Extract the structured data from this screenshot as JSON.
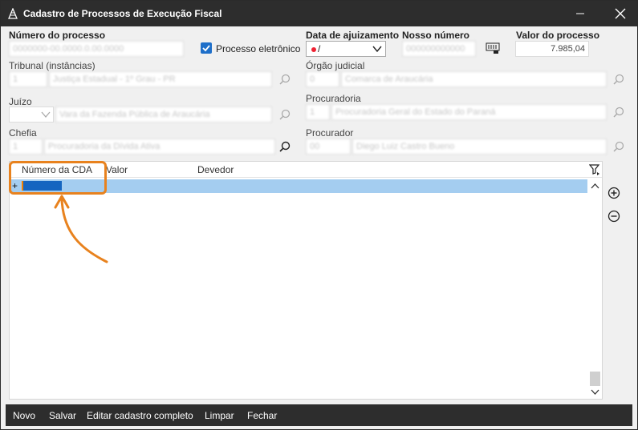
{
  "window": {
    "title": "Cadastro de Processos de Execução Fiscal"
  },
  "form": {
    "numero_processo": {
      "label": "Número do processo",
      "value": "0000000-00.0000.0.00.0000"
    },
    "processo_eletronico": {
      "label": "Processo eletrônico",
      "checked": true
    },
    "data_ajuizamento": {
      "label": "Data de ajuizamento",
      "value": "/"
    },
    "nosso_numero": {
      "label": "Nosso número",
      "value": "000000000000"
    },
    "valor_processo": {
      "label": "Valor do processo",
      "value": "7.985,04"
    },
    "tribunal": {
      "label": "Tribunal (instâncias)",
      "code": "1",
      "value": "Justiça Estadual - 1º Grau - PR"
    },
    "orgao_judicial": {
      "label": "Órgão judicial",
      "code": "0",
      "value": "Comarca de Araucária"
    },
    "juizo": {
      "label": "Juízo",
      "code": "",
      "value": "Vara da Fazenda Pública de Araucária"
    },
    "procuradoria": {
      "label": "Procuradoria",
      "code": "1",
      "value": "Procuradoria Geral do Estado do Paraná"
    },
    "chefia": {
      "label": "Chefia",
      "code": "1",
      "value": "Procuradoria da Dívida Ativa"
    },
    "procurador": {
      "label": "Procurador",
      "code": "00",
      "value": "Diego Luiz Castro Bueno"
    }
  },
  "grid": {
    "columns": [
      "Número da CDA",
      "Valor",
      "Devedor"
    ],
    "rows": [
      {
        "marker": "+",
        "numero_cda": "",
        "valor": "",
        "devedor": ""
      }
    ]
  },
  "toolbar": {
    "novo": "Novo",
    "salvar": "Salvar",
    "editar": "Editar cadastro completo",
    "limpar": "Limpar",
    "fechar": "Fechar"
  },
  "colors": {
    "accent": "#1e6fc9",
    "highlight": "#e8821e",
    "row_selected": "#a4cdf0",
    "titlebar": "#2d2d2d"
  }
}
